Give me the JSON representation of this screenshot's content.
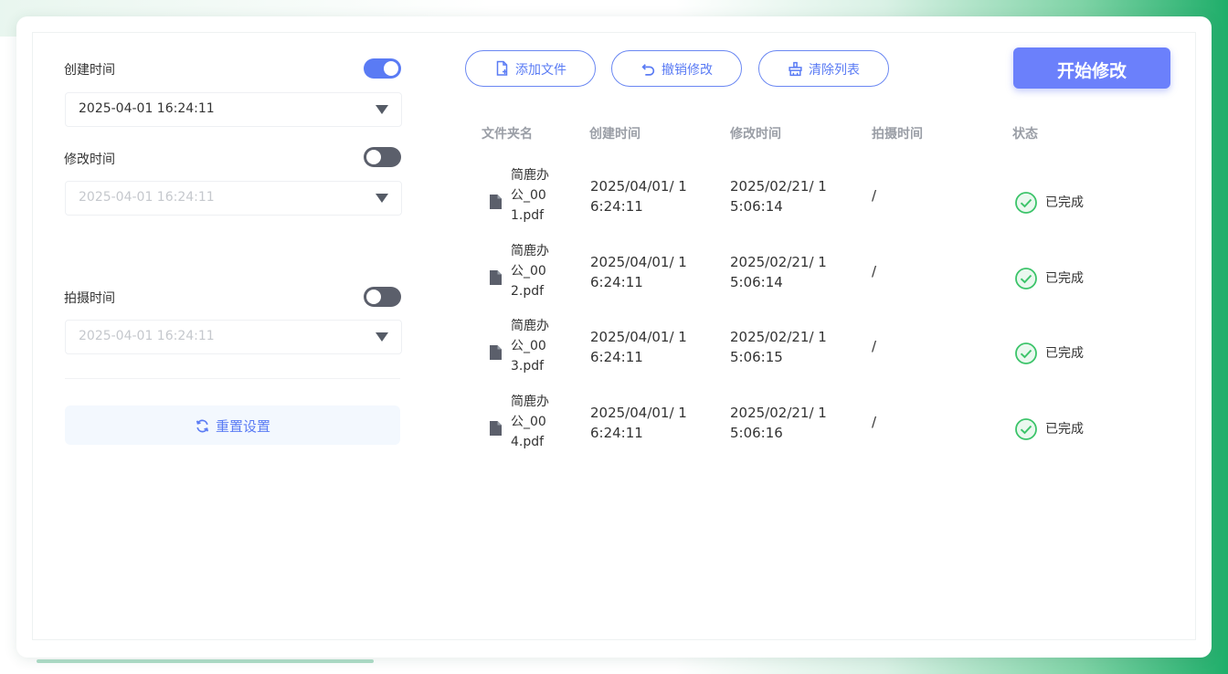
{
  "left_panel": {
    "create_time": {
      "label": "创建时间",
      "value": "2025-04-01 16:24:11",
      "enabled": true
    },
    "modify_time": {
      "label": "修改时间",
      "value": "2025-04-01 16:24:11",
      "enabled": false
    },
    "capture_time": {
      "label": "拍摄时间",
      "value": "2025-04-01 16:24:11",
      "enabled": false
    },
    "reset_label": "重置设置"
  },
  "toolbar": {
    "add_file": "添加文件",
    "undo_modify": "撤销修改",
    "clear_list": "清除列表",
    "start_modify": "开始修改"
  },
  "table": {
    "headers": [
      "文件夹名",
      "创建时间",
      "修改时间",
      "拍摄时间",
      "状态"
    ],
    "rows": [
      {
        "name": "简鹿办公_001.pdf",
        "created": "2025/04/01/ 16:24:11",
        "modified": "2025/02/21/ 15:06:14",
        "captured": "/",
        "status": "已完成"
      },
      {
        "name": "简鹿办公_002.pdf",
        "created": "2025/04/01/ 16:24:11",
        "modified": "2025/02/21/ 15:06:14",
        "captured": "/",
        "status": "已完成"
      },
      {
        "name": "简鹿办公_003.pdf",
        "created": "2025/04/01/ 16:24:11",
        "modified": "2025/02/21/ 15:06:15",
        "captured": "/",
        "status": "已完成"
      },
      {
        "name": "简鹿办公_004.pdf",
        "created": "2025/04/01/ 16:24:11",
        "modified": "2025/02/21/ 15:06:16",
        "captured": "/",
        "status": "已完成"
      }
    ]
  },
  "colors": {
    "accent": "#5a7bf4",
    "primary_button": "#6b80fb",
    "success": "#3cc46a",
    "toggle_off": "#5b5f6b"
  }
}
